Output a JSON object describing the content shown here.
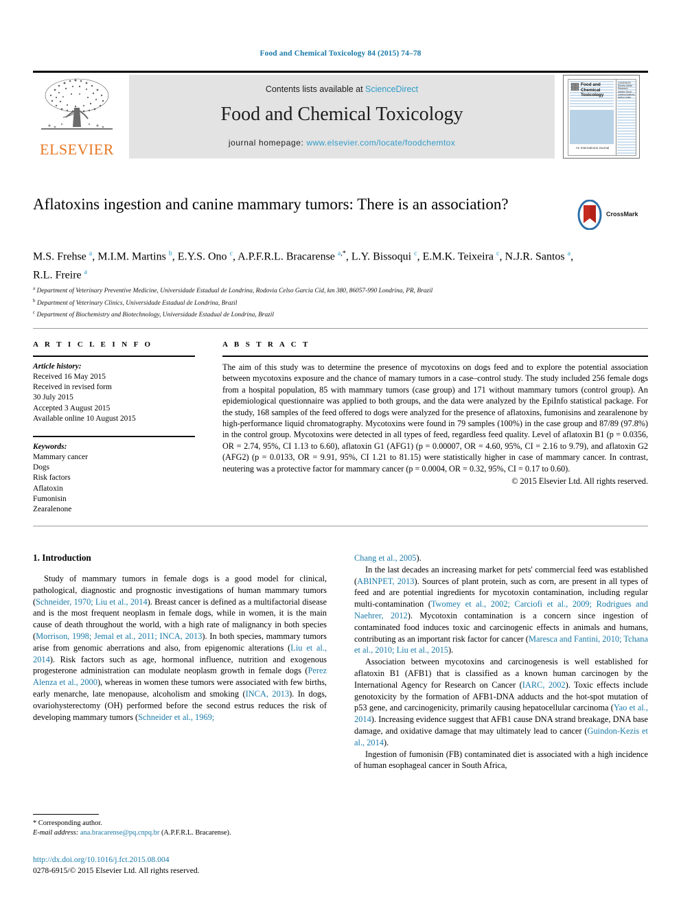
{
  "running_head": "Food and Chemical Toxicology 84 (2015) 74–78",
  "masthead": {
    "contents_prefix": "Contents lists available at ",
    "sciencedirect": "ScienceDirect",
    "journal_title": "Food and Chemical Toxicology",
    "homepage_prefix": "journal homepage: ",
    "homepage_url": "www.elsevier.com/locate/foodchemtox",
    "publisher": "ELSEVIER",
    "publisher_color": "#e87722",
    "link_color": "#2e9bc9",
    "band_color": "#e3e3e3"
  },
  "cover": {
    "journal_name": "Food and Chemical Toxicology",
    "footer": "An International Journal",
    "side_text": "CONTENTS Review article Research articles Short communications Author index",
    "panel_color": "#b9d2e6"
  },
  "article": {
    "title": "Aflatoxins ingestion and canine mammary tumors: There is an association?",
    "crossmark_label": "CrossMark",
    "authors_html": "M.S. Frehse <sup>a</sup>, M.I.M. Martins <sup>b</sup>, E.Y.S. Ono <sup>c</sup>, A.P.F.R.L. Bracarense <sup>a</sup><sup class=\"star\">,*</sup>, L.Y. Bissoqui <sup>c</sup>, E.M.K. Teixeira <sup>c</sup>, N.J.R. Santos <sup>a</sup>, R.L. Freire <sup>a</sup>",
    "affiliations": [
      {
        "label": "a",
        "text": "Department of Veterinary Preventive Medicine, Universidade Estadual de Londrina, Rodovia Celso Garcia Cid, km 380, 86057-990 Londrina, PR, Brazil"
      },
      {
        "label": "b",
        "text": "Department of Veterinary Clinics, Universidade Estadual de Londrina, Brazil"
      },
      {
        "label": "c",
        "text": "Department of Biochemistry and Biotechnology, Universidade Estadual de Londrina, Brazil"
      }
    ]
  },
  "article_info": {
    "heading": "A R T I C L E  I N F O",
    "history_label": "Article history:",
    "history": [
      "Received 16 May 2015",
      "Received in revised form",
      "30 July 2015",
      "Accepted 3 August 2015",
      "Available online 10 August 2015"
    ],
    "keywords_label": "Keywords:",
    "keywords": [
      "Mammary cancer",
      "Dogs",
      "Risk factors",
      "Aflatoxin",
      "Fumonisin",
      "Zearalenone"
    ]
  },
  "abstract": {
    "heading": "A B S T R A C T",
    "text": "The aim of this study was to determine the presence of mycotoxins on dogs feed and to explore the potential association between mycotoxins exposure and the chance of mamary tumors in a case–control study. The study included 256 female dogs from a hospital population, 85 with mammary tumors (case group) and 171 without mammary tumors (control group). An epidemiological questionnaire was applied to both groups, and the data were analyzed by the EpiInfo statistical package. For the study, 168 samples of the feed offered to dogs were analyzed for the presence of aflatoxins, fumonisins and zearalenone by high-performance liquid chromatography. Mycotoxins were found in 79 samples (100%) in the case group and 87/89 (97.8%) in the control group. Mycotoxins were detected in all types of feed, regardless feed quality. Level of aflatoxin B1 (p = 0.0356, OR = 2.74, 95%, CI 1.13 to 6.60), aflatoxin G1 (AFG1) (p = 0.00007, OR = 4.60, 95%, CI = 2.16 to 9.79), and aflatoxin G2 (AFG2) (p = 0.0133, OR = 9.91, 95%, CI 1.21 to 81.15) were statistically higher in case of mammary cancer. In contrast, neutering was a protective factor for mammary cancer (p = 0.0004, OR = 0.32, 95%, CI = 0.17 to 0.60).",
    "copyright": "© 2015 Elsevier Ltd. All rights reserved."
  },
  "body": {
    "section_heading": "1. Introduction",
    "left_paragraphs": [
      "Study of mammary tumors in female dogs is a good model for clinical, pathological, diagnostic and prognostic investigations of human mammary tumors (<span class=\"cite\">Schneider, 1970; Liu et al., 2014</span>). Breast cancer is defined as a multifactorial disease and is the most frequent neoplasm in female dogs, while in women, it is the main cause of death throughout the world, with a high rate of malignancy in both species (<span class=\"cite\">Morrison, 1998; Jemal et al., 2011; INCA, 2013</span>). In both species, mammary tumors arise from genomic aberrations and also, from epigenomic alterations (<span class=\"cite\">Liu et al., 2014</span>). Risk factors such as age, hormonal influence, nutrition and exogenous progesterone administration can modulate neoplasm growth in female dogs (<span class=\"cite\">Perez Alenza et al., 2000</span>), whereas in women these tumors were associated with few births, early menarche, late menopause, alcoholism and smoking (<span class=\"cite\">INCA, 2013</span>). In dogs, ovariohysterectomy (OH) performed before the second estrus reduces the risk of developing mammary tumors (<span class=\"cite\">Schneider et al., 1969;</span>"
    ],
    "right_paragraphs": [
      {
        "indent": false,
        "html": "<span class=\"cite\">Chang et al., 2005</span>)."
      },
      {
        "indent": true,
        "html": "In the last decades an increasing market for pets' commercial feed was established (<span class=\"cite\">ABINPET, 2013</span>). Sources of plant protein, such as corn, are present in all types of feed and are potential ingredients for mycotoxin contamination, including regular multi-contamination (<span class=\"cite\">Twomey et al., 2002; Carciofi et al., 2009; Rodrigues and Naehrer, 2012</span>). Mycotoxin contamination is a concern since ingestion of contaminated food induces toxic and carcinogenic effects in animals and humans, contributing as an important risk factor for cancer (<span class=\"cite\">Maresca and Fantini, 2010; Tchana et al., 2010; Liu et al., 2015</span>)."
      },
      {
        "indent": true,
        "html": "Association between mycotoxins and carcinogenesis is well established for aflatoxin B1 (AFB1) that is classified as a known human carcinogen by the International Agency for Research on Cancer (<span class=\"cite\">IARC, 2002</span>). Toxic effects include genotoxicity by the formation of AFB1-DNA adducts and the hot-spot mutation of p53 gene, and carcinogenicity, primarily causing hepatocellular carcinoma (<span class=\"cite\">Yao et al., 2014</span>). Increasing evidence suggest that AFB1 cause DNA strand breakage, DNA base damage, and oxidative damage that may ultimately lead to cancer (<span class=\"cite\">Guindon-Kezis et al., 2014</span>)."
      },
      {
        "indent": true,
        "html": "Ingestion of fumonisin (FB) contaminated diet is associated with a high incidence of human esophageal cancer in South Africa,"
      }
    ]
  },
  "footnote": {
    "corresponding": "* Corresponding author.",
    "email_label": "E-mail address:",
    "email": "ana.bracarense@pq.cnpq.br",
    "email_suffix": "(A.P.F.R.L. Bracarense)."
  },
  "colophon": {
    "doi": "http://dx.doi.org/10.1016/j.fct.2015.08.004",
    "issn_line": "0278-6915/© 2015 Elsevier Ltd. All rights reserved."
  }
}
